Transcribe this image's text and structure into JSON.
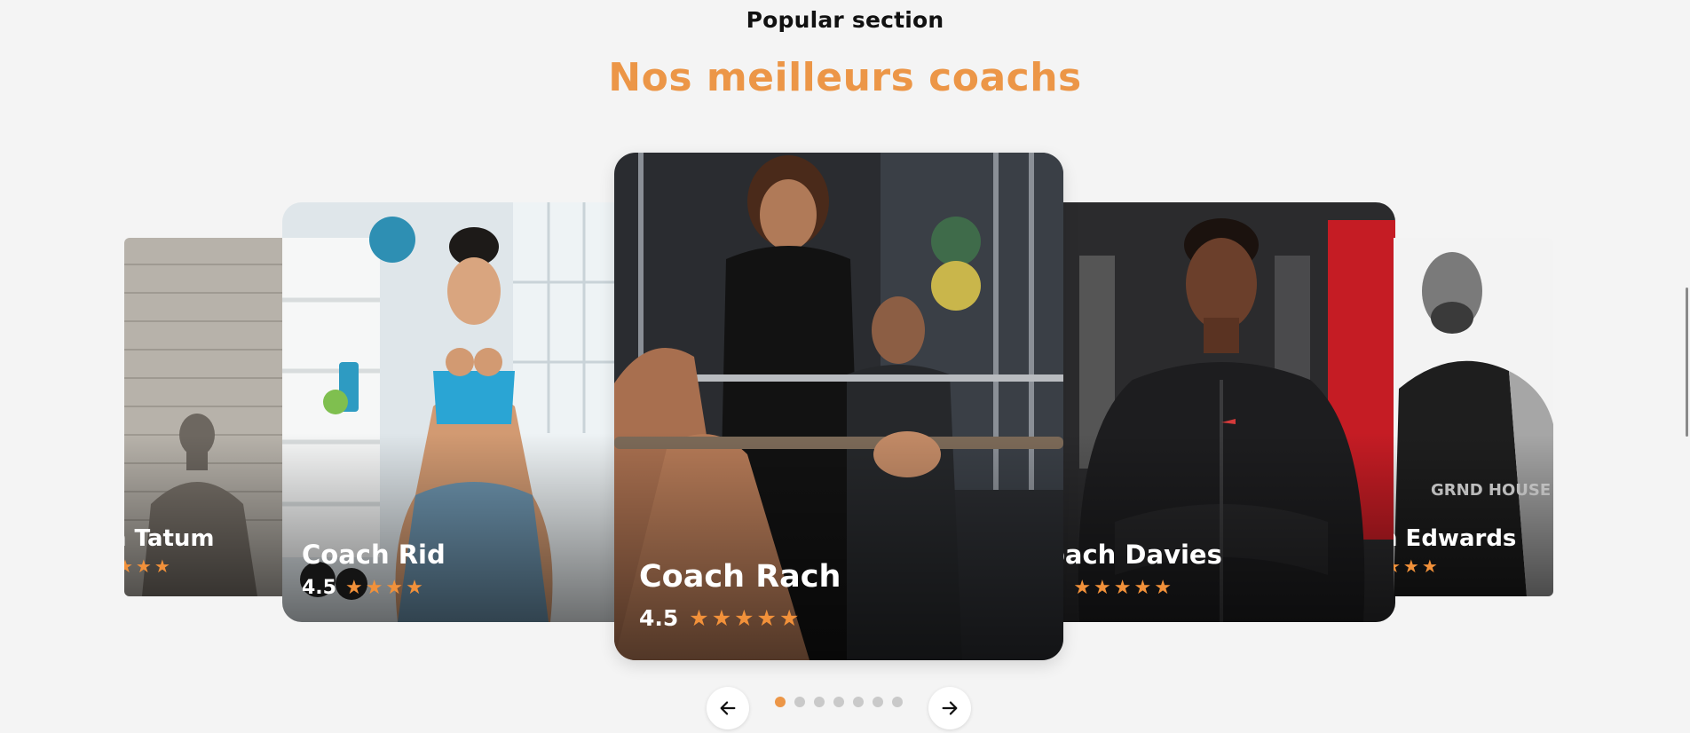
{
  "section": {
    "eyebrow": "Popular section",
    "title": "Nos meilleurs coachs"
  },
  "coaches": [
    {
      "name": "n Tatum",
      "rating": "",
      "stars": "★★★",
      "position": "far-left"
    },
    {
      "name": "Coach Rid",
      "rating": "4.5",
      "stars": "★★★★",
      "position": "left"
    },
    {
      "name": "Coach Rach",
      "rating": "4.5",
      "stars": "★★★★★",
      "position": "center"
    },
    {
      "name": "oach Davies",
      "rating": "5",
      "stars": "★★★★★",
      "position": "right"
    },
    {
      "name": "n Edwards",
      "rating": "",
      "stars": "★★★",
      "position": "far-right"
    }
  ],
  "controls": {
    "prev_icon": "arrow-left-icon",
    "next_icon": "arrow-right-icon",
    "dot_count": 7,
    "active_dot": 0
  },
  "colors": {
    "accent": "#ec9647",
    "background": "#f4f4f4",
    "star": "#f2913a",
    "dot_inactive": "#c9c9c9"
  }
}
